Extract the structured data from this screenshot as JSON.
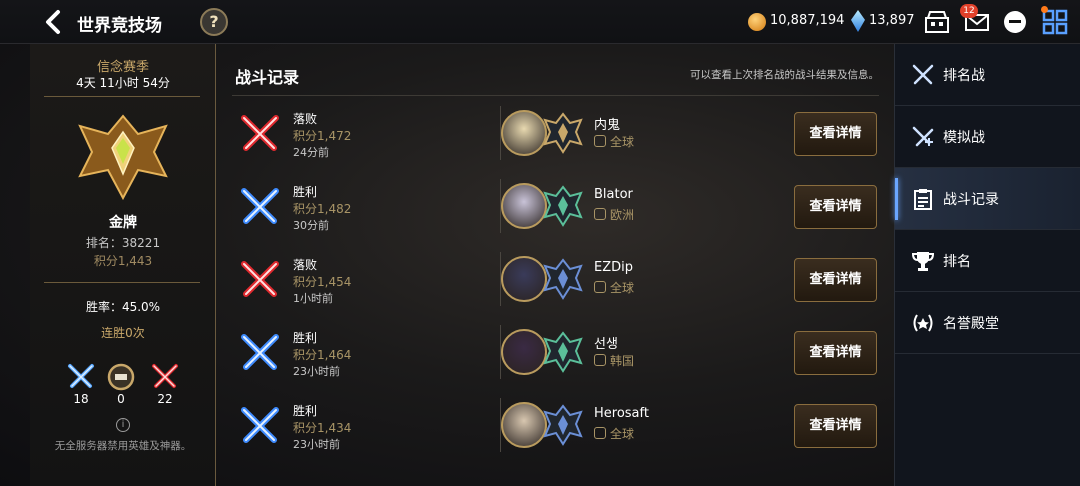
{
  "header": {
    "title": "世界竞技场",
    "help": "?",
    "gold": "10,887,194",
    "crystal": "13,897",
    "mail_badge": "12"
  },
  "season": {
    "name": "信念赛季",
    "time_left": "4天 11小时 54分"
  },
  "player": {
    "tier": "金牌",
    "rank": "排名：38221",
    "points": "积分1,443",
    "win_rate": "胜率：45.0%",
    "streak": "连胜0次",
    "stats": {
      "wins": "18",
      "draws": "0",
      "losses": "22"
    },
    "note": "无全服务器禁用英雄及神器。"
  },
  "main": {
    "title": "战斗记录",
    "hint": "可以查看上次排名战的战斗结果及信息。",
    "detail_label": "查看详情",
    "records": [
      {
        "result": "落败",
        "points": "积分1,472",
        "time": "24分前",
        "opponent": "内鬼",
        "server": "全球"
      },
      {
        "result": "胜利",
        "points": "积分1,482",
        "time": "30分前",
        "opponent": "Blator",
        "server": "欧洲"
      },
      {
        "result": "落败",
        "points": "积分1,454",
        "time": "1小时前",
        "opponent": "EZDip",
        "server": "全球"
      },
      {
        "result": "胜利",
        "points": "积分1,464",
        "time": "23小时前",
        "opponent": "선생",
        "server": "韩国"
      },
      {
        "result": "胜利",
        "points": "积分1,434",
        "time": "23小时前",
        "opponent": "Herosaft",
        "server": "全球"
      }
    ]
  },
  "nav": {
    "items": [
      {
        "label": "排名战",
        "icon": "crossed-swords-icon"
      },
      {
        "label": "模拟战",
        "icon": "sword-plus-icon"
      },
      {
        "label": "战斗记录",
        "icon": "clipboard-icon",
        "active": true
      },
      {
        "label": "排名",
        "icon": "trophy-icon"
      },
      {
        "label": "名誉殿堂",
        "icon": "laurel-icon"
      }
    ]
  },
  "colors": {
    "accent": "#6aa6ff",
    "win": "#3f8cff",
    "loss": "#e0292e",
    "gold": "#c9a86a"
  }
}
